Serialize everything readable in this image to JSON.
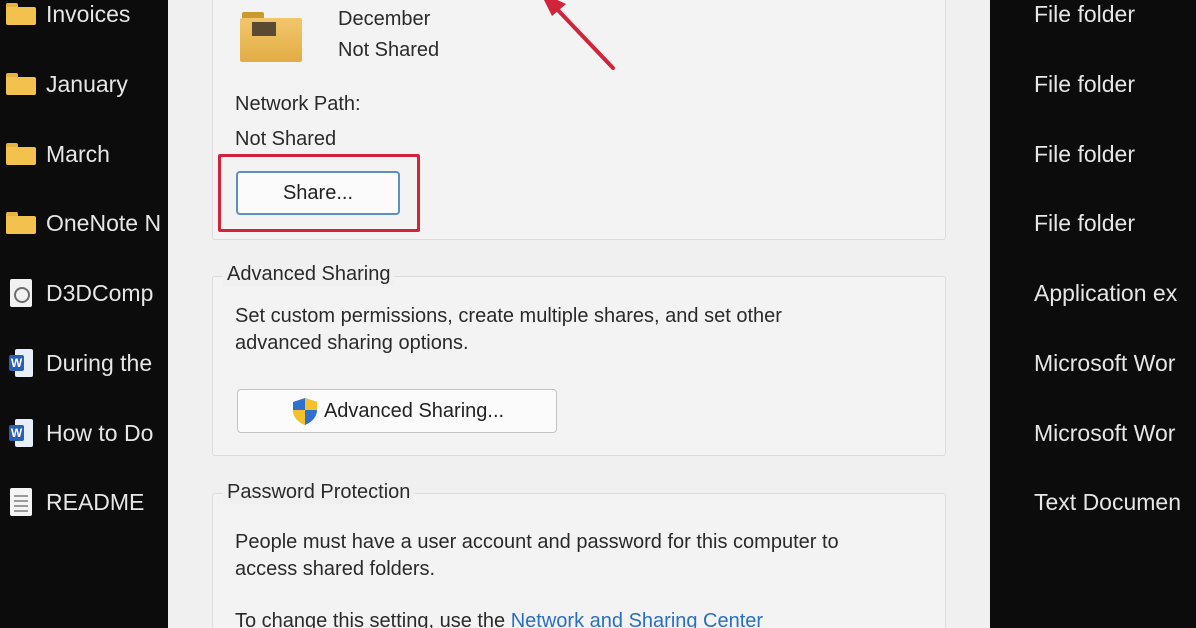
{
  "explorer": {
    "items": [
      {
        "name": "Invoices",
        "icon": "folder-icon"
      },
      {
        "name": "January",
        "icon": "folder-icon"
      },
      {
        "name": "March",
        "icon": "folder-icon"
      },
      {
        "name": "OneNote N",
        "icon": "folder-icon"
      },
      {
        "name": "D3DComp",
        "icon": "application-icon"
      },
      {
        "name": "During the",
        "icon": "word-document-icon"
      },
      {
        "name": "How to Do",
        "icon": "word-document-icon"
      },
      {
        "name": "README",
        "icon": "text-document-icon"
      }
    ],
    "types": [
      "File folder",
      "File folder",
      "File folder",
      "File folder",
      "Application ex",
      "Microsoft Wor",
      "Microsoft Wor",
      "Text Documen"
    ]
  },
  "dialog": {
    "folder_name": "December",
    "folder_status": "Not Shared",
    "network_path_label": "Network Path:",
    "network_path_value": "Not Shared",
    "share_button": "Share...",
    "advanced_sharing": {
      "title": "Advanced Sharing",
      "description_line1": "Set custom permissions, create multiple shares, and set other",
      "description_line2": "advanced sharing options.",
      "button": "Advanced Sharing..."
    },
    "password_protection": {
      "title": "Password Protection",
      "description_line1": "People must have a user account and password for this computer to",
      "description_line2": "access shared folders.",
      "change_text": "To change this setting, use the ",
      "link": "Network and Sharing Center"
    }
  },
  "colors": {
    "highlight": "#d0243a",
    "link": "#2a6fc0",
    "folder": "#f2c14e",
    "background_dark": "#0c0c0c",
    "dialog_bg": "#f0f0f0"
  }
}
